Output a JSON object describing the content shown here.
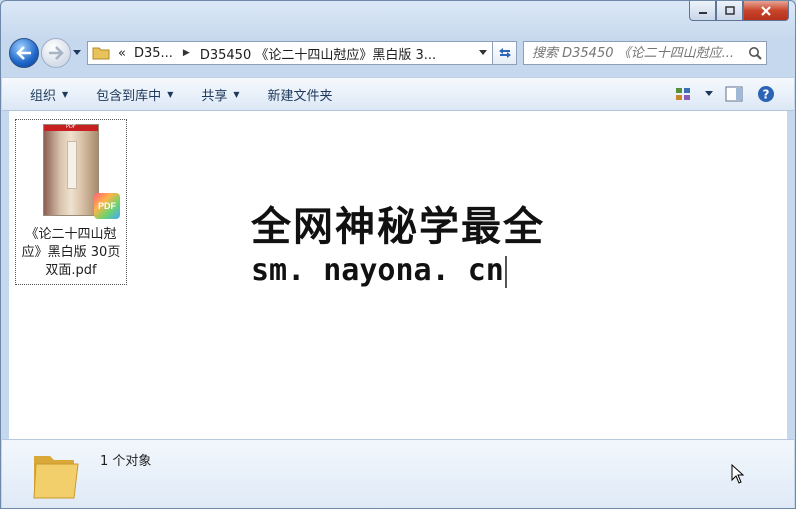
{
  "window": {
    "caption": {
      "minimize_icon": "minimize-icon",
      "maximize_icon": "maximize-icon",
      "close_icon": "close-icon"
    }
  },
  "nav": {
    "address_overflow": "«",
    "breadcrumbs": [
      "D35...",
      "D35450 《论二十四山尅应》黑白版 3..."
    ],
    "search_placeholder": "搜索 D35450 《论二十四山尅应..."
  },
  "toolbar": {
    "organize": "组织",
    "include_in_library": "包含到库中",
    "share": "共享",
    "new_folder": "新建文件夹"
  },
  "file": {
    "name": "《论二十四山尅应》黑白版 30页双面.pdf",
    "thumb_header": "PDF",
    "badge": "PDF"
  },
  "watermark": {
    "line1": "全网神秘学最全",
    "line2": "sm. nayona. cn"
  },
  "details": {
    "status": "1 个对象"
  },
  "colors": {
    "accent": "#1d66c8",
    "close": "#c8452b",
    "cmd_text": "#1e395b"
  }
}
